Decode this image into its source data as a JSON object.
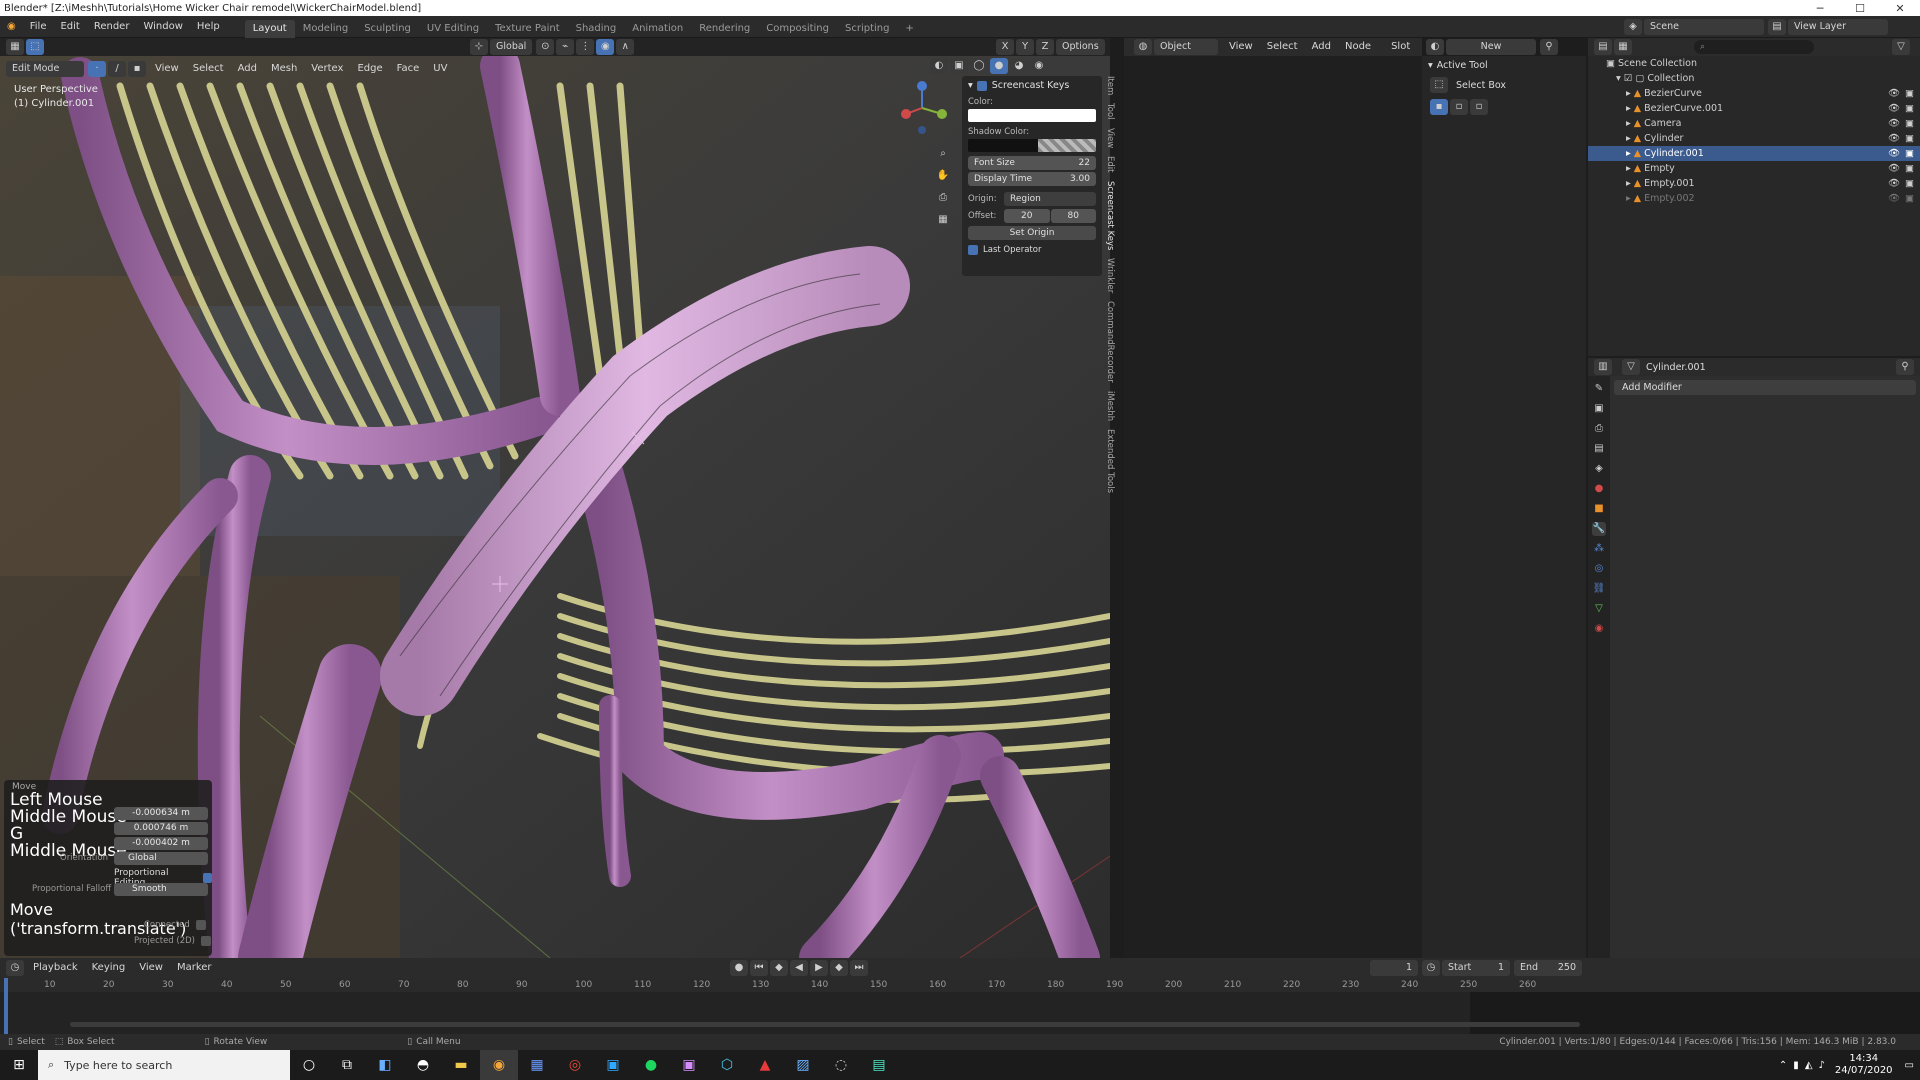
{
  "window": {
    "title": "Blender* [Z:\\iMeshh\\Tutorials\\Home Wicker Chair remodel\\WickerChairModel.blend]",
    "minimize": "─",
    "maximize": "☐",
    "close": "✕"
  },
  "menu": [
    "File",
    "Edit",
    "Render",
    "Window",
    "Help"
  ],
  "workspaces": [
    "Layout",
    "Modeling",
    "Sculpting",
    "UV Editing",
    "Texture Paint",
    "Shading",
    "Animation",
    "Rendering",
    "Compositing",
    "Scripting"
  ],
  "workspace_add": "+",
  "scene": {
    "label": "Scene",
    "view_layer": "View Layer"
  },
  "viewport": {
    "mode": "Edit Mode",
    "menus": [
      "View",
      "Select",
      "Add",
      "Mesh",
      "Vertex",
      "Edge",
      "Face",
      "UV"
    ],
    "transform": "Global",
    "options": "Options",
    "axes": [
      "X",
      "Y",
      "Z"
    ],
    "perspective": "User Perspective",
    "object": "(1) Cylinder.001"
  },
  "npanel": {
    "header": "Screencast Keys",
    "color_label": "Color:",
    "shadow_label": "Shadow Color:",
    "font_size_label": "Font Size",
    "font_size": "22",
    "display_time_label": "Display Time",
    "display_time": "3.00",
    "origin_label": "Origin:",
    "origin_value": "Region",
    "offset_label": "Offset:",
    "offset_x": "20",
    "offset_y": "80",
    "set_origin": "Set Origin",
    "last_operator": "Last Operator",
    "tabs": [
      "Item",
      "Tool",
      "View",
      "Edit",
      "Screencast Keys",
      "Wrinkler",
      "CommandRecorder",
      "iMeshh",
      "Extended Tools"
    ]
  },
  "node_editor": {
    "mode": "Object",
    "menus": [
      "View",
      "Select",
      "Add",
      "Node"
    ],
    "slot": "Slot",
    "new": "New"
  },
  "active_tool": {
    "title": "Active Tool",
    "tool": "Select Box"
  },
  "outliner": {
    "root": "Scene Collection",
    "collection": "Collection",
    "items": [
      {
        "name": "BezierCurve",
        "selected": false,
        "dim": false
      },
      {
        "name": "BezierCurve.001",
        "selected": false,
        "dim": false
      },
      {
        "name": "Camera",
        "selected": false,
        "dim": false
      },
      {
        "name": "Cylinder",
        "selected": false,
        "dim": false
      },
      {
        "name": "Cylinder.001",
        "selected": true,
        "dim": false
      },
      {
        "name": "Empty",
        "selected": false,
        "dim": false
      },
      {
        "name": "Empty.001",
        "selected": false,
        "dim": false
      },
      {
        "name": "Empty.002",
        "selected": false,
        "dim": true
      }
    ]
  },
  "properties": {
    "object": "Cylinder.001",
    "add_modifier": "Add Modifier"
  },
  "operator_panel": {
    "title": "Move",
    "keys": [
      "Left Mouse",
      "Middle Mouse",
      "G",
      "Middle Mouse"
    ],
    "values": [
      "-0.000634 m",
      "0.000746 m",
      "-0.000402 m"
    ],
    "orientation_label": "Orientation",
    "orientation": "Global",
    "proportional_editing": "Proportional Editing",
    "falloff_label": "Proportional Falloff",
    "falloff": "Smooth",
    "connected": "Connected",
    "projected": "Projected (2D)",
    "last_op": "Move ('transform.translate')"
  },
  "timeline": {
    "menus": [
      "Playback",
      "Keying",
      "View",
      "Marker"
    ],
    "current_frame": "1",
    "start_label": "Start",
    "start": "1",
    "end_label": "End",
    "end": "250",
    "ticks": [
      "10",
      "20",
      "30",
      "40",
      "50",
      "60",
      "70",
      "80",
      "90",
      "100",
      "110",
      "120",
      "130",
      "140",
      "150",
      "160",
      "170",
      "180",
      "190",
      "200",
      "210",
      "220",
      "230",
      "240",
      "250",
      "260"
    ]
  },
  "statusbar": {
    "select": "Select",
    "box_select": "Box Select",
    "rotate_view": "Rotate View",
    "call_menu": "Call Menu",
    "stats": "Cylinder.001 | Verts:1/80 | Edges:0/144 | Faces:0/66 | Tris:156 | Mem: 146.3 MiB | 2.83.0"
  },
  "taskbar": {
    "search_placeholder": "Type here to search",
    "time": "14:34",
    "date": "24/07/2020"
  },
  "colors": {
    "accent": "#4772b3",
    "selection": "#3b5a8e",
    "chair_purple": "#b07ab6",
    "wicker": "#c8c58a"
  }
}
